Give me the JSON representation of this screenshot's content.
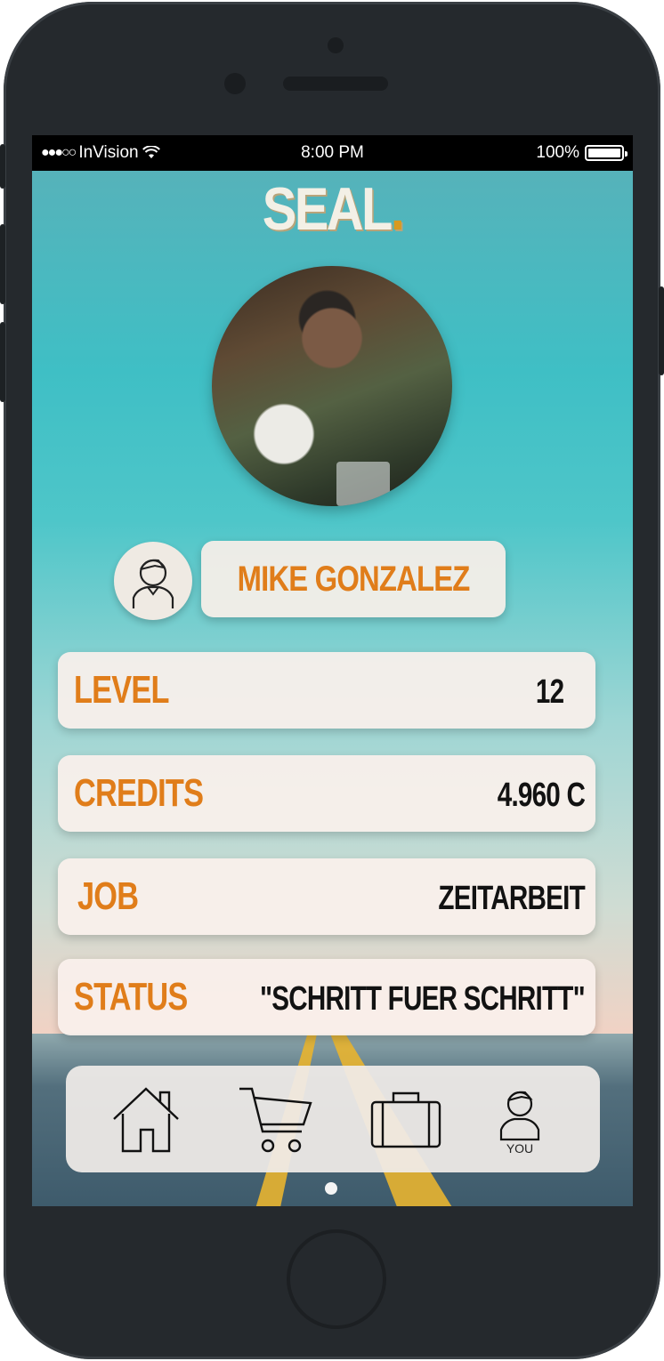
{
  "status_bar": {
    "signal": "●●●○○",
    "carrier": "InVision",
    "time": "8:00 PM",
    "battery": "100%"
  },
  "app": {
    "logo": "SEAL",
    "logo_dot": "."
  },
  "profile": {
    "name": "MIKE GONZALEZ",
    "stats": [
      {
        "label": "LEVEL",
        "value": "12"
      },
      {
        "label": "CREDITS",
        "value": "4.960 C"
      },
      {
        "label": "JOB",
        "value": "ZEITARBEIT"
      },
      {
        "label": "STATUS",
        "value": "\"SCHRITT FUER SCHRITT\""
      }
    ]
  },
  "tabbar": {
    "tabs": [
      {
        "icon": "home-icon"
      },
      {
        "icon": "cart-icon"
      },
      {
        "icon": "briefcase-icon"
      },
      {
        "icon": "user-icon",
        "label": "YOU"
      }
    ]
  },
  "colors": {
    "accent": "#e07d1a",
    "device": "#25292d"
  }
}
